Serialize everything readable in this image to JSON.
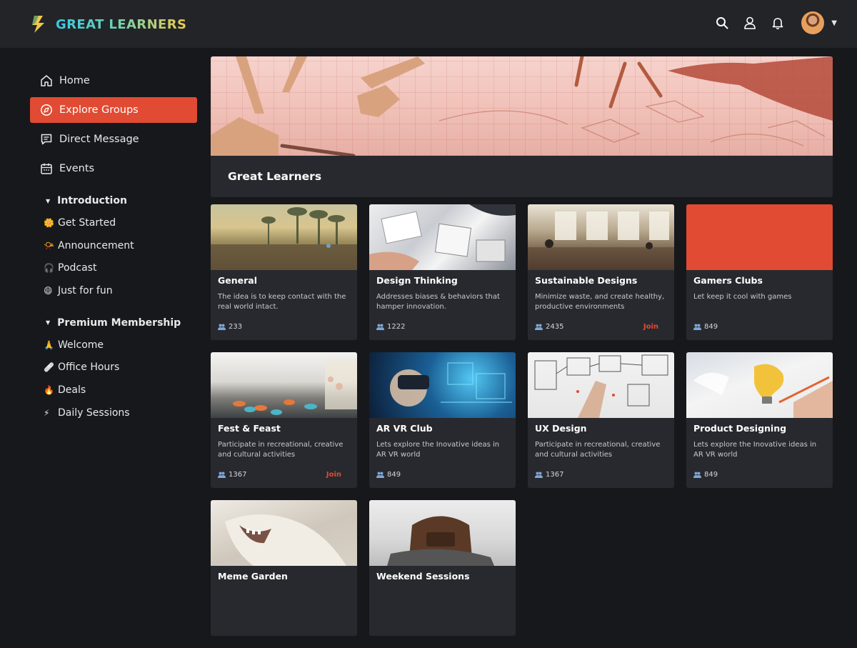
{
  "app": {
    "name": "GREAT LEARNERS"
  },
  "header": {
    "icons": [
      "search-icon",
      "user-icon",
      "bell-icon",
      "avatar",
      "chevron-down-icon"
    ]
  },
  "colors": {
    "accent": "#e14b33",
    "background": "#17181b",
    "panel": "#28292e",
    "topbar": "#232428"
  },
  "sidebar": {
    "nav": [
      {
        "label": "Home",
        "icon": "home-icon",
        "active": false
      },
      {
        "label": "Explore Groups",
        "icon": "explore-icon",
        "active": true
      },
      {
        "label": "Direct Message",
        "icon": "message-icon",
        "active": false
      },
      {
        "label": "Events",
        "icon": "calendar-icon",
        "active": false
      }
    ],
    "sections": [
      {
        "title": "Introduction",
        "items": [
          {
            "emoji": "🌼",
            "label": "Get Started"
          },
          {
            "emoji": "📯",
            "label": "Announcement"
          },
          {
            "emoji": "🎧",
            "label": "Podcast"
          },
          {
            "emoji": "😄",
            "label": "Just for fun"
          }
        ]
      },
      {
        "title": "Premium Membership",
        "items": [
          {
            "emoji": "🙏",
            "label": "Welcome"
          },
          {
            "emoji": "🩹",
            "label": "Office Hours"
          },
          {
            "emoji": "🔥",
            "label": "Deals"
          },
          {
            "emoji": "⚡",
            "label": "Daily Sessions"
          }
        ]
      }
    ]
  },
  "hero": {
    "title": "Great Learners"
  },
  "groups": [
    {
      "title": "General",
      "desc": "The idea is to keep contact with the real world intact.",
      "count": "233",
      "join": ""
    },
    {
      "title": "Design Thinking",
      "desc": "Addresses biases & behaviors that hamper innovation.",
      "count": "1222",
      "join": ""
    },
    {
      "title": "Sustainable Designs",
      "desc": "Minimize waste, and create healthy, productive environments",
      "count": "2435",
      "join": "Join"
    },
    {
      "title": "Gamers Clubs",
      "desc": "Let keep it cool with games",
      "count": "849",
      "join": ""
    },
    {
      "title": "Fest & Feast",
      "desc": "Participate in recreational, creative and cultural activities",
      "count": "1367",
      "join": "Join"
    },
    {
      "title": "AR VR Club",
      "desc": "Lets explore the Inovative ideas in AR VR world",
      "count": "849",
      "join": ""
    },
    {
      "title": "UX Design",
      "desc": "Participate in recreational, creative and cultural activities",
      "count": "1367",
      "join": ""
    },
    {
      "title": "Product Designing",
      "desc": "Lets explore the Inovative ideas in AR VR world",
      "count": "849",
      "join": ""
    },
    {
      "title": "Meme Garden",
      "desc": "",
      "count": "",
      "join": ""
    },
    {
      "title": "Weekend Sessions",
      "desc": "",
      "count": "",
      "join": ""
    }
  ]
}
